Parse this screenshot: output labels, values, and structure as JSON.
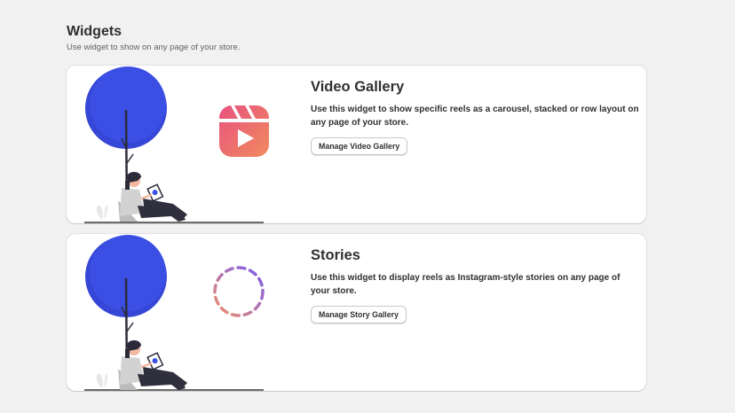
{
  "header": {
    "title": "Widgets",
    "subtitle": "Use widget to show on any page of your store."
  },
  "widgets": [
    {
      "title": "Video Gallery",
      "description": "Use this widget to show specific reels as a carousel, stacked or row layout on any page of your store.",
      "button_label": "Manage Video Gallery",
      "icon": "reels-icon"
    },
    {
      "title": "Stories",
      "description": "Use this widget to display reels as Instagram-style stories on any page of your store.",
      "button_label": "Manage Story Gallery",
      "icon": "stories-ring-icon"
    }
  ],
  "colors": {
    "tree": "#3b4fe4",
    "reels_gradient_start": "#e8517f",
    "reels_gradient_end": "#f08b5e",
    "ring_start": "#7b5cf0",
    "ring_end": "#f0906b"
  }
}
